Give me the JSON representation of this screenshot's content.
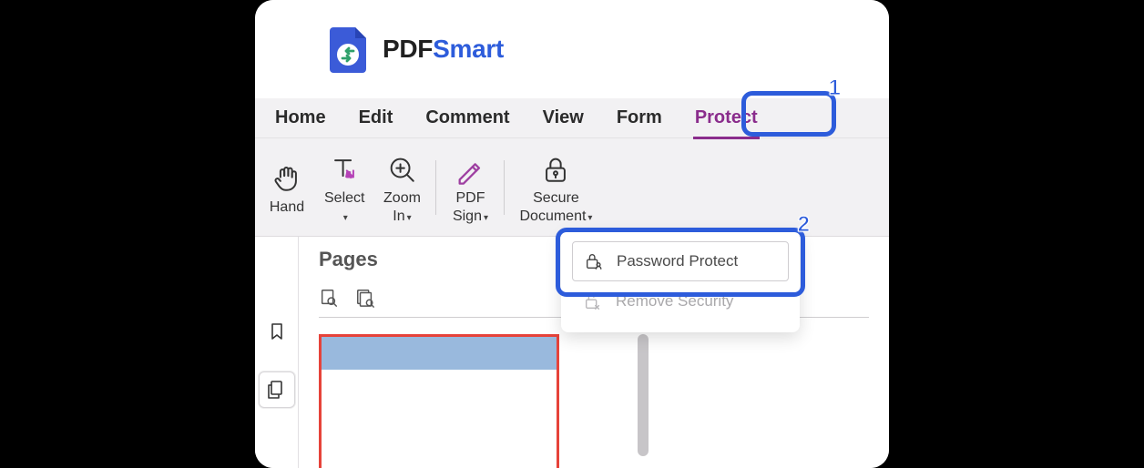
{
  "app": {
    "brand_prefix": "PDF",
    "brand_suffix": "Smart"
  },
  "menu": {
    "items": [
      "Home",
      "Edit",
      "Comment",
      "View",
      "Form",
      "Protect"
    ],
    "active_index": 5
  },
  "toolbar": {
    "hand": "Hand",
    "select": "Select",
    "zoom_in_l1": "Zoom",
    "zoom_in_l2": "In",
    "pdf_sign_l1": "PDF",
    "pdf_sign_l2": "Sign",
    "secure_l1": "Secure",
    "secure_l2": "Document"
  },
  "pages_panel": {
    "title": "Pages"
  },
  "popup": {
    "password_protect": "Password Protect",
    "remove_security": "Remove Security"
  },
  "callouts": {
    "c1": "1",
    "c2": "2"
  }
}
